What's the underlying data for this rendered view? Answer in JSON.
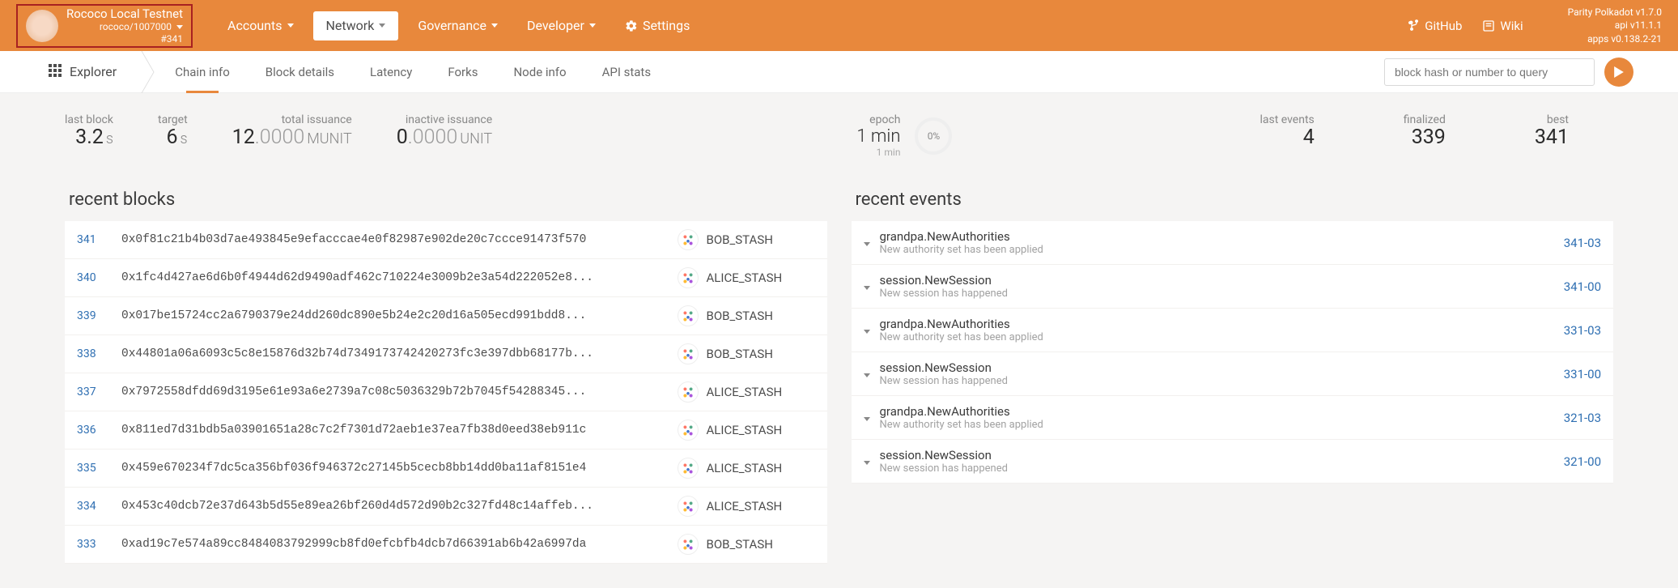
{
  "chain": {
    "name": "Rococo Local Testnet",
    "spec": "rococo/1007000",
    "block_num": "#341"
  },
  "nav": {
    "accounts": "Accounts",
    "network": "Network",
    "governance": "Governance",
    "developer": "Developer",
    "settings": "Settings"
  },
  "links": {
    "github": "GitHub",
    "wiki": "Wiki"
  },
  "version": {
    "l1": "Parity Polkadot v1.7.0",
    "l2": "api v11.1.1",
    "l3": "apps v0.138.2-21"
  },
  "subtabs": {
    "explorer": "Explorer",
    "chain_info": "Chain info",
    "block_details": "Block details",
    "latency": "Latency",
    "forks": "Forks",
    "node_info": "Node info",
    "api_stats": "API stats"
  },
  "search": {
    "placeholder": "block hash or number to query"
  },
  "stats": {
    "last_block": {
      "label": "last block",
      "value": "3.2",
      "unit": "s"
    },
    "target": {
      "label": "target",
      "value": "6",
      "unit": "s"
    },
    "total_issuance": {
      "label": "total issuance",
      "int": "12",
      "frac": ".0000",
      "unit": "MUNIT"
    },
    "inactive_issuance": {
      "label": "inactive issuance",
      "int": "0",
      "frac": ".0000",
      "unit": "UNIT"
    },
    "epoch": {
      "label": "epoch",
      "value": "1 min",
      "sub": "1 min",
      "pct": "0%"
    },
    "last_events": {
      "label": "last events",
      "value": "4"
    },
    "finalized": {
      "label": "finalized",
      "value": "339"
    },
    "best": {
      "label": "best",
      "value": "341"
    }
  },
  "blocks_title": "recent blocks",
  "events_title": "recent events",
  "blocks": [
    {
      "num": "341",
      "hash": "0x0f81c21b4b03d7ae493845e9efacccae4e0f82987e902de20c7ccce91473f570",
      "author": "BOB_STASH"
    },
    {
      "num": "340",
      "hash": "0x1fc4d427ae6d6b0f4944d62d9490adf462c710224e3009b2e3a54d222052e8...",
      "author": "ALICE_STASH"
    },
    {
      "num": "339",
      "hash": "0x017be15724cc2a6790379e24dd260dc890e5b24e2c20d16a505ecd991bdd8...",
      "author": "BOB_STASH"
    },
    {
      "num": "338",
      "hash": "0x44801a06a6093c5c8e15876d32b74d7349173742420273fc3e397dbb68177b...",
      "author": "BOB_STASH"
    },
    {
      "num": "337",
      "hash": "0x7972558dfdd69d3195e61e93a6e2739a7c08c5036329b72b7045f54288345...",
      "author": "ALICE_STASH"
    },
    {
      "num": "336",
      "hash": "0x811ed7d31bdb5a03901651a28c7c2f7301d72aeb1e37ea7fb38d0eed38eb911c",
      "author": "ALICE_STASH"
    },
    {
      "num": "335",
      "hash": "0x459e670234f7dc5ca356bf036f946372c27145b5cecb8bb14dd0ba11af8151e4",
      "author": "ALICE_STASH"
    },
    {
      "num": "334",
      "hash": "0x453c40dcb72e37d643b5d55e89ea26bf260d4d572d90b2c327fd48c14affeb...",
      "author": "ALICE_STASH"
    },
    {
      "num": "333",
      "hash": "0xad19c7e574a89cc8484083792999cb8fd0efcbfb4dcb7d66391ab6b42a6997da",
      "author": "BOB_STASH"
    }
  ],
  "events": [
    {
      "title": "grandpa.NewAuthorities",
      "desc": "New authority set has been applied",
      "id": "341-03"
    },
    {
      "title": "session.NewSession",
      "desc": "New session has happened",
      "id": "341-00"
    },
    {
      "title": "grandpa.NewAuthorities",
      "desc": "New authority set has been applied",
      "id": "331-03"
    },
    {
      "title": "session.NewSession",
      "desc": "New session has happened",
      "id": "331-00"
    },
    {
      "title": "grandpa.NewAuthorities",
      "desc": "New authority set has been applied",
      "id": "321-03"
    },
    {
      "title": "session.NewSession",
      "desc": "New session has happened",
      "id": "321-00"
    }
  ]
}
